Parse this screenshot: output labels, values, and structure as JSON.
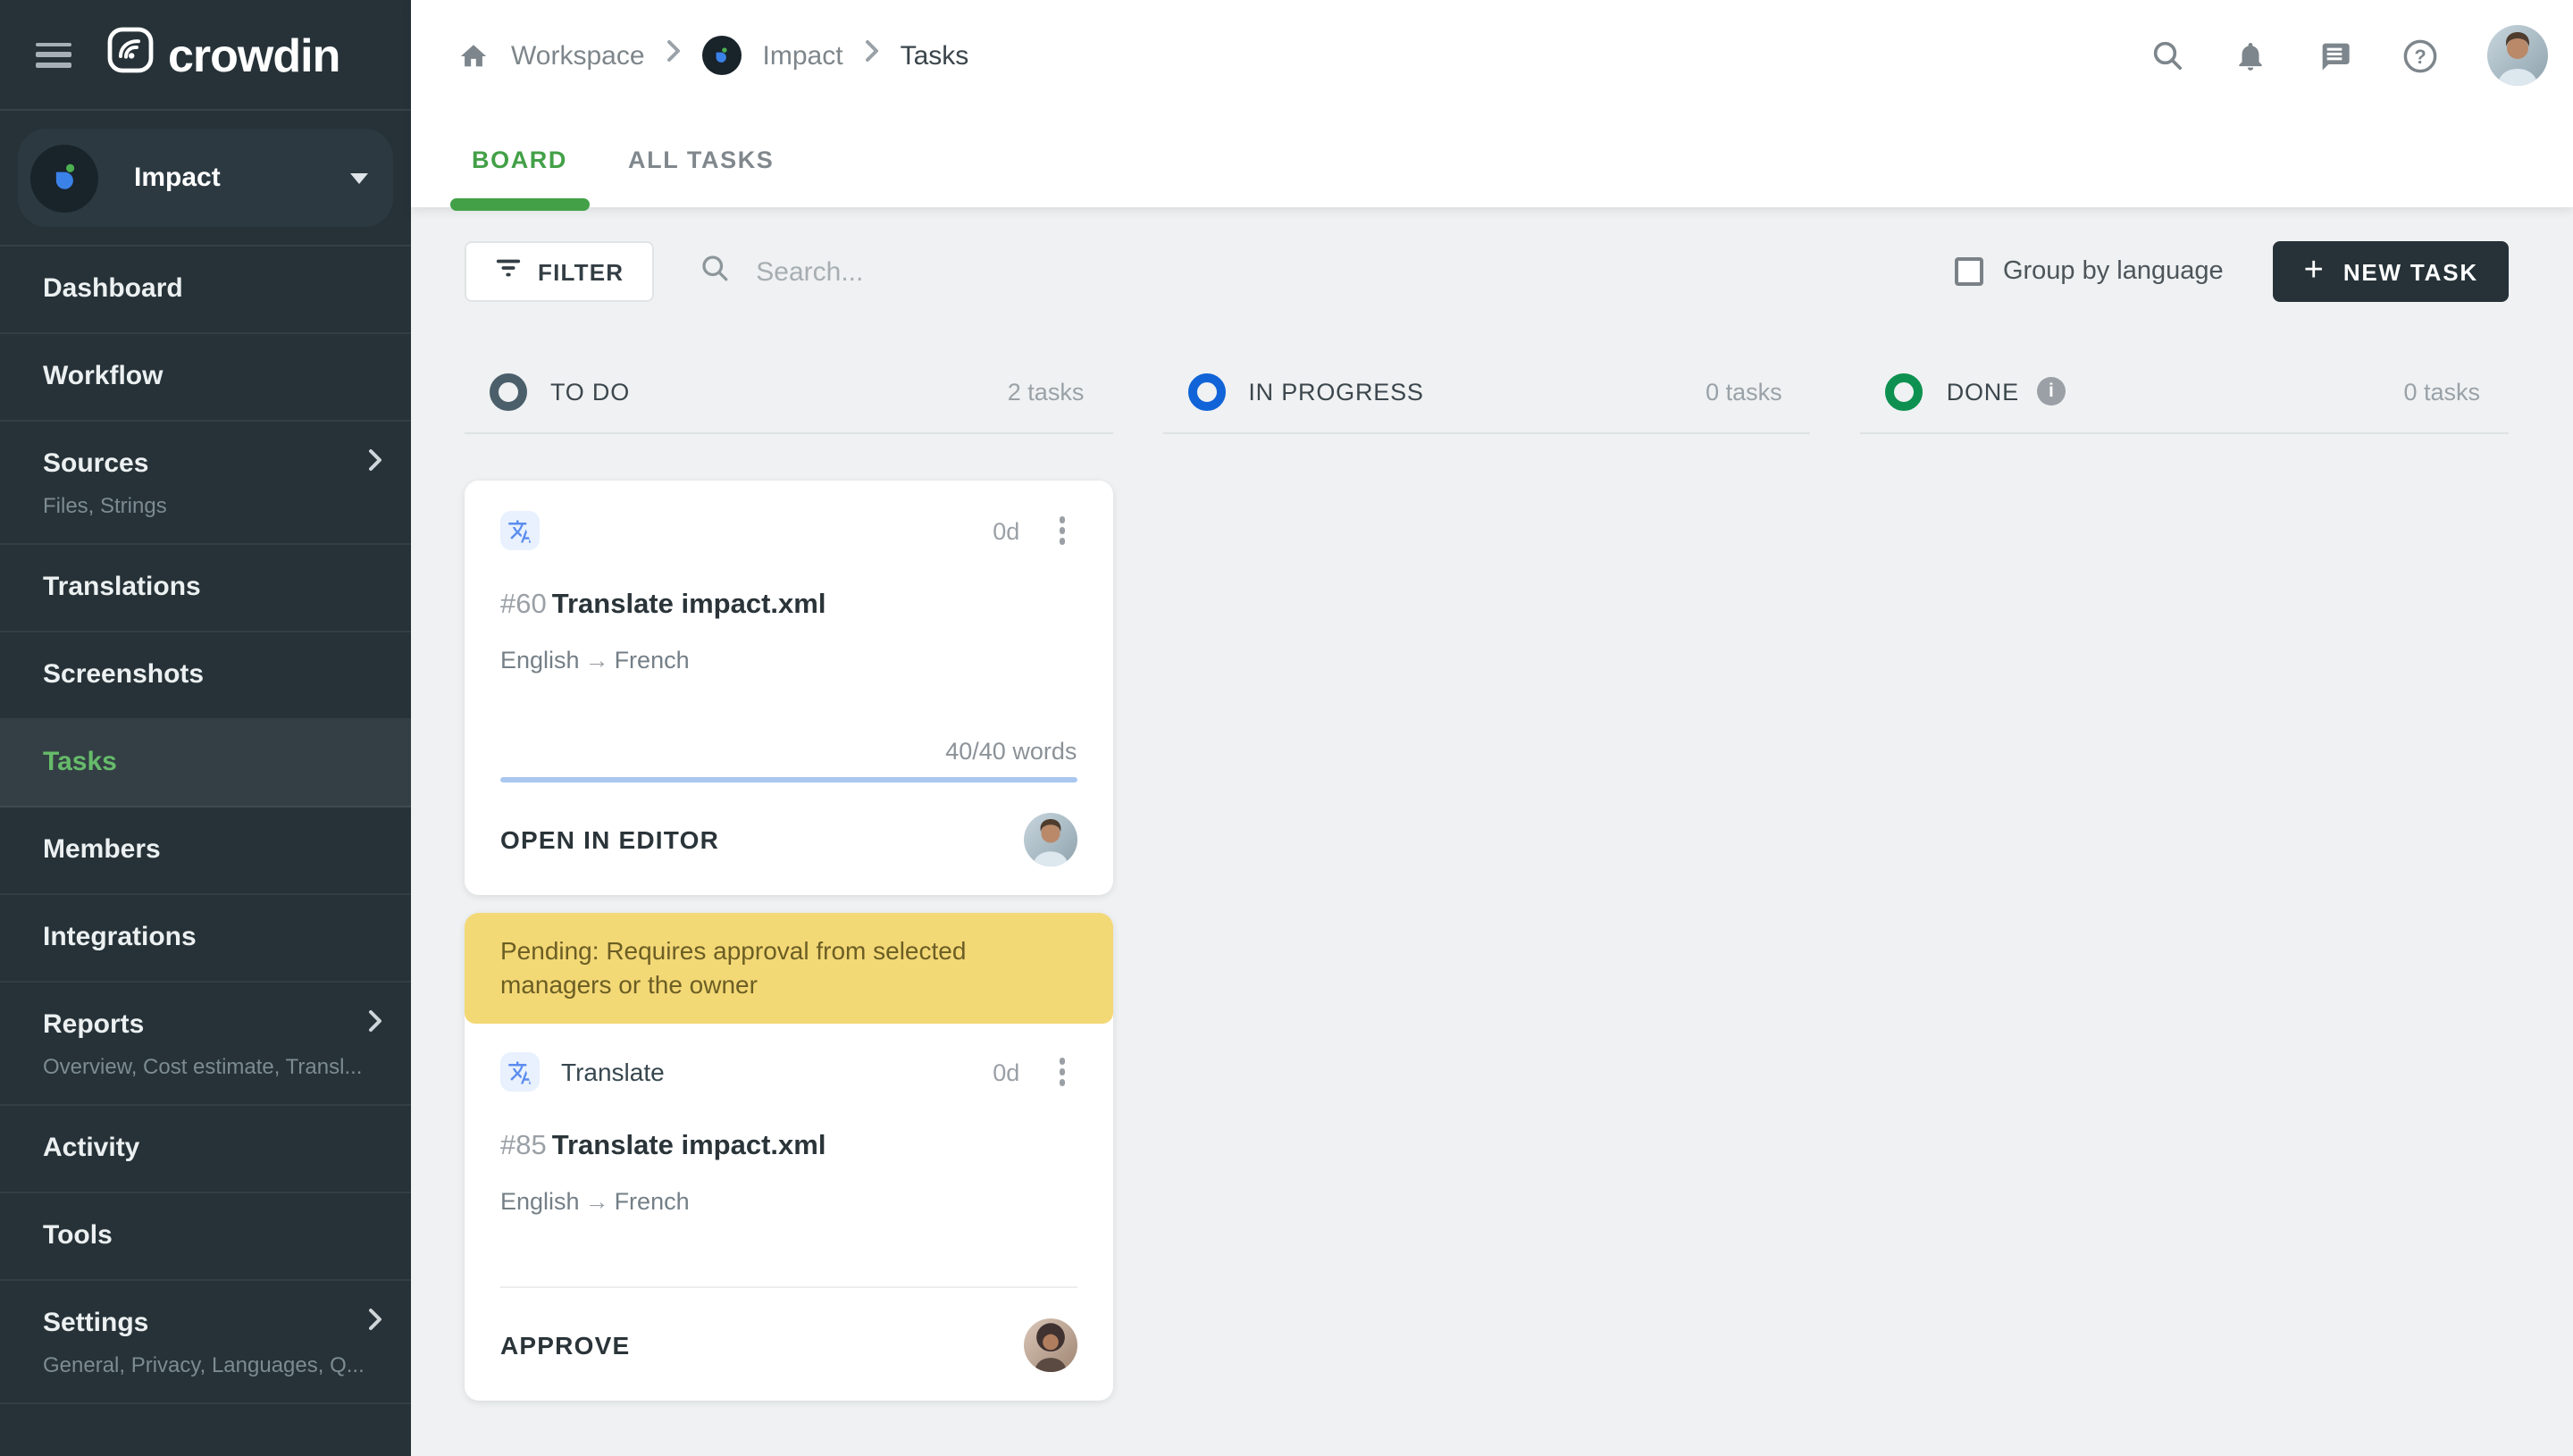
{
  "app": {
    "brand": "crowdin",
    "project_name": "Impact"
  },
  "sidebar": {
    "items": [
      {
        "label": "Dashboard"
      },
      {
        "label": "Workflow"
      },
      {
        "label": "Sources",
        "subtitle": "Files, Strings",
        "has_submenu": true
      },
      {
        "label": "Translations"
      },
      {
        "label": "Screenshots"
      },
      {
        "label": "Tasks",
        "active": true
      },
      {
        "label": "Members"
      },
      {
        "label": "Integrations"
      },
      {
        "label": "Reports",
        "subtitle": "Overview, Cost estimate, Transl...",
        "has_submenu": true
      },
      {
        "label": "Activity"
      },
      {
        "label": "Tools"
      },
      {
        "label": "Settings",
        "subtitle": "General, Privacy, Languages, Q...",
        "has_submenu": true
      }
    ]
  },
  "breadcrumb": {
    "workspace": "Workspace",
    "project": "Impact",
    "current": "Tasks"
  },
  "tabs": {
    "board": "BOARD",
    "all_tasks": "ALL TASKS"
  },
  "toolbar": {
    "filter": "FILTER",
    "search_placeholder": "Search...",
    "group_by": "Group by language",
    "group_by_checked": false,
    "new_task_plus": "+",
    "new_task": "NEW TASK"
  },
  "columns": [
    {
      "name": "TO DO",
      "count": "2 tasks"
    },
    {
      "name": "IN PROGRESS",
      "count": "0 tasks"
    },
    {
      "name": "DONE",
      "count": "0 tasks",
      "has_info": true,
      "info_glyph": "i"
    }
  ],
  "cards": {
    "task60": {
      "duration": "0d",
      "id": "#60",
      "title": "Translate impact.xml",
      "source_language": "English",
      "target_language": "French",
      "words": "40/40 words",
      "progress_percent": 100,
      "action": "OPEN IN EDITOR"
    },
    "task85": {
      "banner": "Pending: Requires approval from selected managers or the owner",
      "type": "Translate",
      "duration": "0d",
      "id": "#85",
      "title": "Translate impact.xml",
      "source_language": "English",
      "target_language": "French",
      "action": "APPROVE"
    }
  },
  "ui": {
    "lang_arrow": "→"
  },
  "icons": {
    "topbar": [
      "search-icon",
      "bell-icon",
      "chat-icon",
      "help-icon"
    ],
    "task_type": "translate-icon"
  },
  "colors": {
    "sidebar_bg": "#263238",
    "accent_green": "#43a047",
    "sidebar_active_green": "#66bb6a",
    "todo_ring": "#4b5f6b",
    "in_progress_ring": "#1164d8",
    "done_ring": "#0e9150",
    "progress_bar": "#a9c7ef",
    "banner_bg": "#f3d876",
    "banner_text": "#6b5e24",
    "new_task_bg": "#263238"
  }
}
